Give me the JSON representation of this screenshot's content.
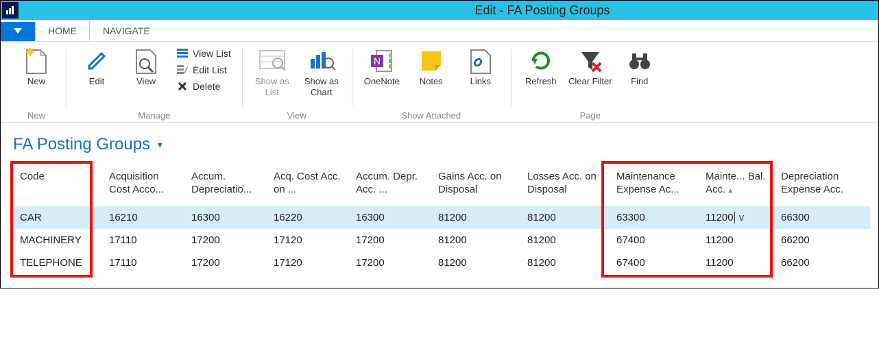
{
  "window": {
    "title": "Edit - FA Posting Groups"
  },
  "tabs": {
    "home": "HOME",
    "navigate": "NAVIGATE"
  },
  "ribbon": {
    "new": {
      "new": "New",
      "group": "New"
    },
    "manage": {
      "edit": "Edit",
      "view": "View",
      "view_list": "View List",
      "edit_list": "Edit List",
      "delete": "Delete",
      "group": "Manage"
    },
    "viewg": {
      "show_list": "Show as List",
      "show_chart": "Show as Chart",
      "group": "View"
    },
    "attached": {
      "onenote": "OneNote",
      "notes": "Notes",
      "links": "Links",
      "group": "Show Attached"
    },
    "page": {
      "refresh": "Refresh",
      "clear_filter": "Clear Filter",
      "find": "Find",
      "group": "Page"
    }
  },
  "page_heading": "FA Posting Groups",
  "columns": [
    "Code",
    "Acquisition Cost Acco...",
    "Accum. Depreciatio...",
    "Acq. Cost Acc. on ...",
    "Accum. Depr. Acc. ...",
    "Gains Acc. on Disposal",
    "Losses Acc. on Disposal",
    "Maintenance Expense Ac...",
    "Mainte... Bal. Acc.",
    "Depreciation Expense Acc."
  ],
  "rows": [
    {
      "code": "CAR",
      "c1": "16210",
      "c2": "16300",
      "c3": "16220",
      "c4": "16300",
      "c5": "81200",
      "c6": "81200",
      "c7": "63300",
      "c8": "11200",
      "c9": "66300"
    },
    {
      "code": "MACHINERY",
      "c1": "17110",
      "c2": "17200",
      "c3": "17120",
      "c4": "17200",
      "c5": "81200",
      "c6": "81200",
      "c7": "67400",
      "c8": "11200",
      "c9": "66200"
    },
    {
      "code": "TELEPHONE",
      "c1": "17110",
      "c2": "17200",
      "c3": "17120",
      "c4": "17200",
      "c5": "81200",
      "c6": "81200",
      "c7": "67400",
      "c8": "11200",
      "c9": "66200"
    }
  ]
}
